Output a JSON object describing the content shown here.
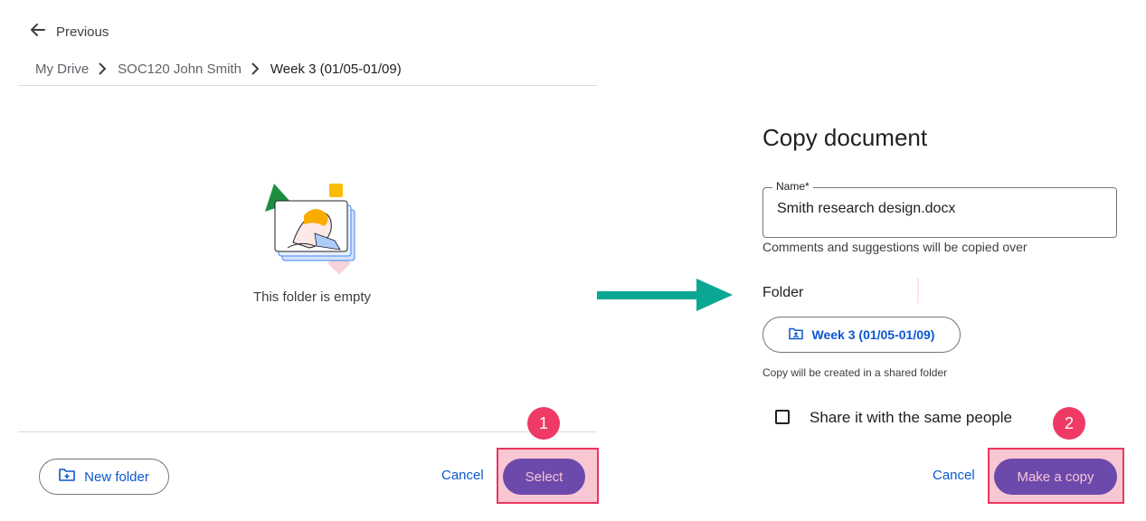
{
  "left_panel": {
    "previous_label": "Previous",
    "breadcrumb": [
      "My Drive",
      "SOC120 John Smith",
      "Week 3 (01/05-01/09)"
    ],
    "empty_message": "This folder is empty",
    "new_folder_label": "New folder",
    "cancel_label": "Cancel",
    "select_label": "Select",
    "step_number": "1"
  },
  "right_panel": {
    "title": "Copy document",
    "name_field_label": "Name*",
    "name_value": "Smith research design.docx",
    "helper_text": "Comments and suggestions will be copied over",
    "folder_heading": "Folder",
    "folder_chip_label": "Week 3 (01/05-01/09)",
    "shared_note": "Copy will be created in a shared folder",
    "share_checkbox_label": "Share it with the same people",
    "share_checked": false,
    "cancel_label": "Cancel",
    "make_copy_label": "Make a copy",
    "step_number": "2"
  },
  "colors": {
    "link_blue": "#0b57d0",
    "primary_button": "#6b4aac",
    "highlight_fill": "#f9c6d3",
    "highlight_border": "#e8375f",
    "badge": "#ee3a64",
    "arrow": "#0aa894"
  },
  "icons": [
    "arrow-back-icon",
    "chevron-right-icon",
    "empty-folder-illustration",
    "new-folder-icon",
    "shared-folder-icon",
    "teal-arrow"
  ]
}
